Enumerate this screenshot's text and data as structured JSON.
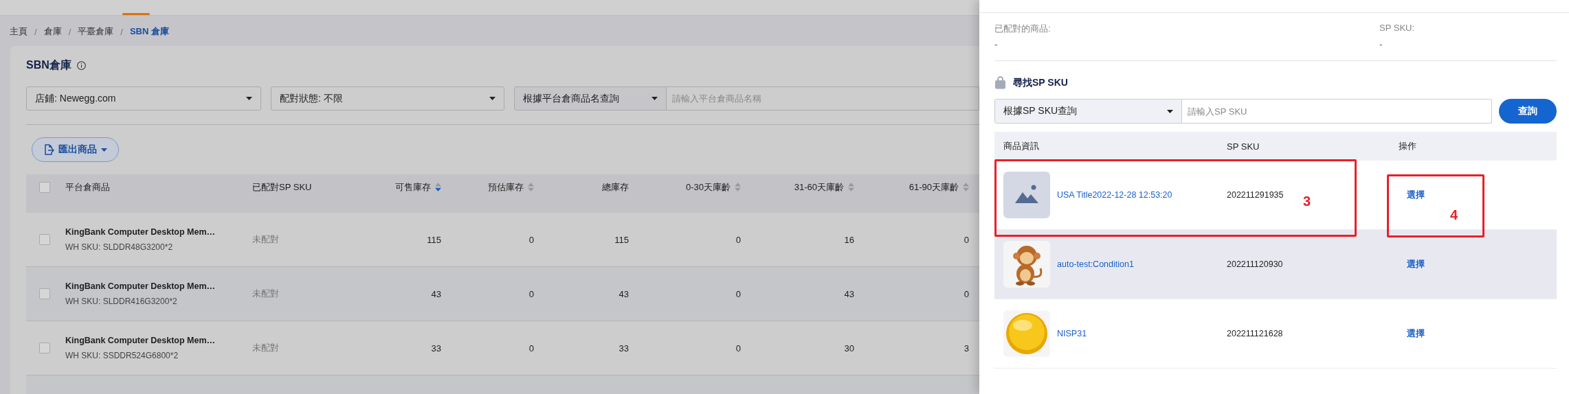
{
  "breadcrumb": [
    {
      "label": "主頁",
      "current": false
    },
    {
      "separator": "/",
      "label": "倉庫",
      "current": false
    },
    {
      "separator": "/",
      "label": "平臺倉庫",
      "current": false
    },
    {
      "separator": "/",
      "label": "SBN 倉庫",
      "current": true
    }
  ],
  "page_title": "SBN倉庫",
  "filters": {
    "store": "店鋪: Newegg.com",
    "match_status": "配對狀態: 不限",
    "search_mode": "根據平台倉商品名查詢",
    "search_placeholder": "請輸入平台倉商品名稱"
  },
  "export_button": "匯出商品",
  "table": {
    "select_all_checked": false,
    "columns": [
      {
        "label": "平台倉商品",
        "sortable": false
      },
      {
        "label": "已配對SP SKU",
        "sortable": false
      },
      {
        "label": "可售庫存",
        "sortable": true,
        "sorted_descending": true
      },
      {
        "label": "預估庫存",
        "sortable": true,
        "sorted_descending": false
      },
      {
        "label": "總庫存",
        "sortable": false
      },
      {
        "label": "0-30天庫齡",
        "sortable": true,
        "sorted_descending": false
      },
      {
        "label": "31-60天庫齡",
        "sortable": true,
        "sorted_descending": false
      },
      {
        "label": "61-90天庫齡",
        "sortable": true,
        "sorted_descending": false
      }
    ],
    "rows": [
      {
        "checked": false,
        "title": "KingBank Computer Desktop Mem…",
        "wh_sku": "WH SKU: SLDDR48G3200*2",
        "matched": "未配對",
        "values": [
          "115",
          "0",
          "115",
          "0",
          "16",
          "0"
        ]
      },
      {
        "checked": false,
        "title": "KingBank Computer Desktop Mem…",
        "wh_sku": "WH SKU: SLDDR416G3200*2",
        "matched": "未配對",
        "values": [
          "43",
          "0",
          "43",
          "0",
          "43",
          "0"
        ]
      },
      {
        "checked": false,
        "title": "KingBank Computer Desktop Mem…",
        "wh_sku": "WH SKU: SSDDR524G6800*2",
        "matched": "未配對",
        "values": [
          "33",
          "0",
          "33",
          "0",
          "30",
          "3"
        ]
      }
    ]
  },
  "drawer": {
    "matched_product": {
      "label": "已配對的商品:",
      "value": "-"
    },
    "sp_sku": {
      "label": "SP SKU:",
      "value": "-"
    },
    "search_title": "尋找SP SKU",
    "search_mode": "根據SP SKU查詢",
    "search_placeholder": "請輸入SP SKU",
    "search_button": "查詢",
    "table": {
      "columns": [
        "商品資訊",
        "SP SKU",
        "操作"
      ],
      "rows": [
        {
          "kind": "placeholder",
          "name": "USA Title2022-12-28 12:53:20",
          "sku": "202211291935",
          "action": "選擇",
          "highlighted": false
        },
        {
          "kind": "picture",
          "name": "auto-test:Condition1",
          "sku": "202211120930",
          "action": "選擇",
          "highlighted": true
        },
        {
          "kind": "picture",
          "name": "NISP31",
          "sku": "202211121628",
          "action": "選擇",
          "highlighted": false
        }
      ]
    },
    "annotations": [
      {
        "label": "3"
      },
      {
        "label": "4"
      }
    ]
  }
}
